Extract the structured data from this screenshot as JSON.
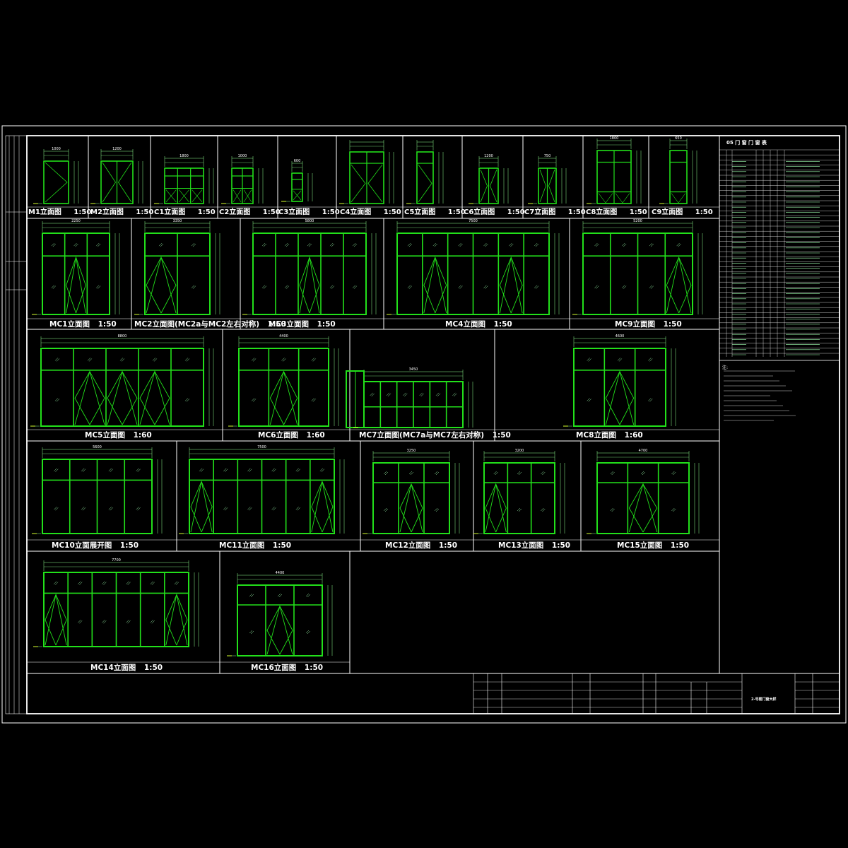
{
  "drawing": {
    "colors": {
      "background": "#000000",
      "frame": "#ffffff",
      "mullion": "#22e01a",
      "glass_line": "#9fffb0",
      "dimension": "#8fff8f",
      "accent": "#d6ff2e"
    },
    "row1": [
      {
        "id": "M1",
        "label": "M1立面图",
        "scale": "1:50",
        "width_dim": "1000"
      },
      {
        "id": "M2",
        "label": "M2立面图",
        "scale": "1:50",
        "width_dim": "1200"
      },
      {
        "id": "C1",
        "label": "C1立面图",
        "scale": "1:50",
        "width_dim": "1800"
      },
      {
        "id": "C2",
        "label": "C2立面图",
        "scale": "1:50",
        "width_dim": "1000"
      },
      {
        "id": "C3",
        "label": "C3立面图",
        "scale": "1:50",
        "width_dim": "600"
      },
      {
        "id": "C4",
        "label": "C4立面图",
        "scale": "1:50",
        "width_dim": ""
      },
      {
        "id": "C5",
        "label": "C5立面图",
        "scale": "1:50",
        "width_dim": ""
      },
      {
        "id": "C6",
        "label": "C6立面图",
        "scale": "1:50",
        "width_dim": "1200"
      },
      {
        "id": "C7",
        "label": "C7立面图",
        "scale": "1:50",
        "width_dim": "750"
      },
      {
        "id": "C8",
        "label": "C8立面图",
        "scale": "1:50",
        "width_dim": "1800"
      },
      {
        "id": "C9",
        "label": "C9立面图",
        "scale": "1:50",
        "width_dim": "650"
      }
    ],
    "row2": [
      {
        "id": "MC1",
        "label": "MC1立面图",
        "scale": "1:50",
        "width_dim": "2250"
      },
      {
        "id": "MC2",
        "label": "MC2立面图(MC2a与MC2左右对称)",
        "scale": "1:50",
        "width_dim": "3350"
      },
      {
        "id": "MC3",
        "label": "MC3立面图",
        "scale": "1:50",
        "width_dim": "5800"
      },
      {
        "id": "MC4",
        "label": "MC4立面图",
        "scale": "1:50",
        "width_dim": "7500"
      },
      {
        "id": "MC9",
        "label": "MC9立面图",
        "scale": "1:50",
        "width_dim": "5200"
      }
    ],
    "row3": [
      {
        "id": "MC5",
        "label": "MC5立面图",
        "scale": "1:60",
        "width_dim": "8800"
      },
      {
        "id": "MC6",
        "label": "MC6立面图",
        "scale": "1:60",
        "width_dim": "4400"
      },
      {
        "id": "MC7",
        "label": "MC7立面图(MC7a与MC7左右对称)",
        "scale": "1:50",
        "width_dim": "3450"
      },
      {
        "id": "MC8",
        "label": "MC8立面图",
        "scale": "1:60",
        "width_dim": "4600"
      }
    ],
    "row4": [
      {
        "id": "MC10",
        "label": "MC10立面展开图",
        "scale": "1:50",
        "width_dim": "5600"
      },
      {
        "id": "MC11",
        "label": "MC11立面图",
        "scale": "1:50",
        "width_dim": "7500"
      },
      {
        "id": "MC12",
        "label": "MC12立面图",
        "scale": "1:50",
        "width_dim": "3250"
      },
      {
        "id": "MC13",
        "label": "MC13立面图",
        "scale": "1:50",
        "width_dim": "3200"
      },
      {
        "id": "MC15",
        "label": "MC15立面图",
        "scale": "1:50",
        "width_dim": "4700"
      }
    ],
    "row5": [
      {
        "id": "MC14",
        "label": "MC14立面图",
        "scale": "1:50",
        "width_dim": "7700"
      },
      {
        "id": "MC16",
        "label": "MC16立面图",
        "scale": "1:50",
        "width_dim": "4400"
      }
    ],
    "schedule": {
      "title": "05 门 窗 门 窗 表",
      "notes_title": "注:"
    },
    "title_block": {
      "drawing_name": "2-号楼门窗大样"
    }
  }
}
